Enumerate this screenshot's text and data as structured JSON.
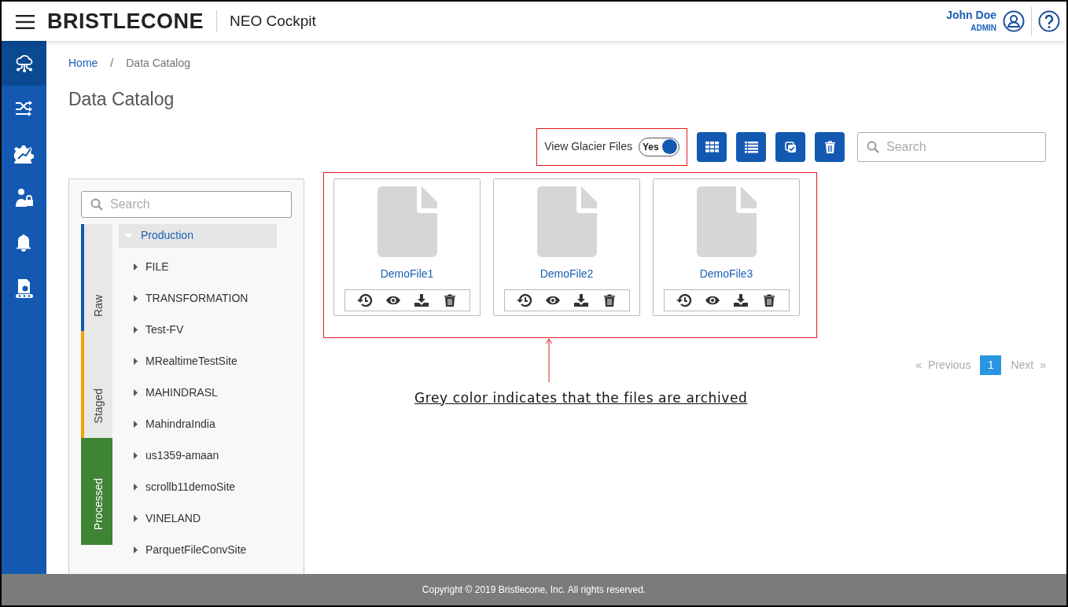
{
  "header": {
    "brand": "BRISTLECONE",
    "app_name": "NEO Cockpit",
    "user_name": "John Doe",
    "user_role": "ADMIN"
  },
  "nav_items": [
    {
      "kind": "cloud",
      "selected": true
    },
    {
      "kind": "shuffle",
      "selected": false
    },
    {
      "kind": "gear",
      "selected": false
    },
    {
      "kind": "user-lock",
      "selected": false
    },
    {
      "kind": "bell",
      "selected": false
    },
    {
      "kind": "conveyor",
      "selected": false
    }
  ],
  "breadcrumb": [
    "Home",
    "Data Catalog"
  ],
  "breadcrumb_separator": "/",
  "page_title": "Data Catalog",
  "glacier_toggle": {
    "label": "View Glacier Files",
    "state_text": "Yes",
    "on": true
  },
  "search": {
    "placeholder": "Search"
  },
  "panel": {
    "search_placeholder": "Search",
    "stages": [
      {
        "label": "Raw",
        "color": "#1259b0",
        "selected": false
      },
      {
        "label": "Staged",
        "color": "#f5a30a",
        "selected": false
      },
      {
        "label": "Processed",
        "color": "#3f8434",
        "selected": true
      }
    ],
    "tree": [
      {
        "label": "Production",
        "expanded": true,
        "selected": true,
        "children": [
          {
            "label": "FILE",
            "expanded": false
          },
          {
            "label": "TRANSFORMATION",
            "expanded": false
          },
          {
            "label": "Test-FV",
            "expanded": false
          },
          {
            "label": "MRealtimeTestSite",
            "expanded": false
          },
          {
            "label": "MAHINDRASL",
            "expanded": false
          },
          {
            "label": "MahindraIndia",
            "expanded": false
          },
          {
            "label": "us1359-amaan",
            "expanded": false
          },
          {
            "label": "scrollb11demoSite",
            "expanded": false
          },
          {
            "label": "VINELAND",
            "expanded": false
          },
          {
            "label": "ParquetFileConvSite",
            "expanded": false
          }
        ]
      }
    ]
  },
  "files": [
    {
      "name": "DemoFile1",
      "archived": true
    },
    {
      "name": "DemoFile2",
      "archived": true
    },
    {
      "name": "DemoFile3",
      "archived": true
    }
  ],
  "pagination": {
    "prev_mark": "«",
    "previous": "Previous",
    "pages": [
      {
        "label": "1",
        "selected": true
      }
    ],
    "next": "Next",
    "next_mark": "»"
  },
  "annotation": {
    "text": "Grey color indicates that the files are archived"
  },
  "footer": "Copyright © 2019 Bristlecone, Inc. All rights reserved."
}
